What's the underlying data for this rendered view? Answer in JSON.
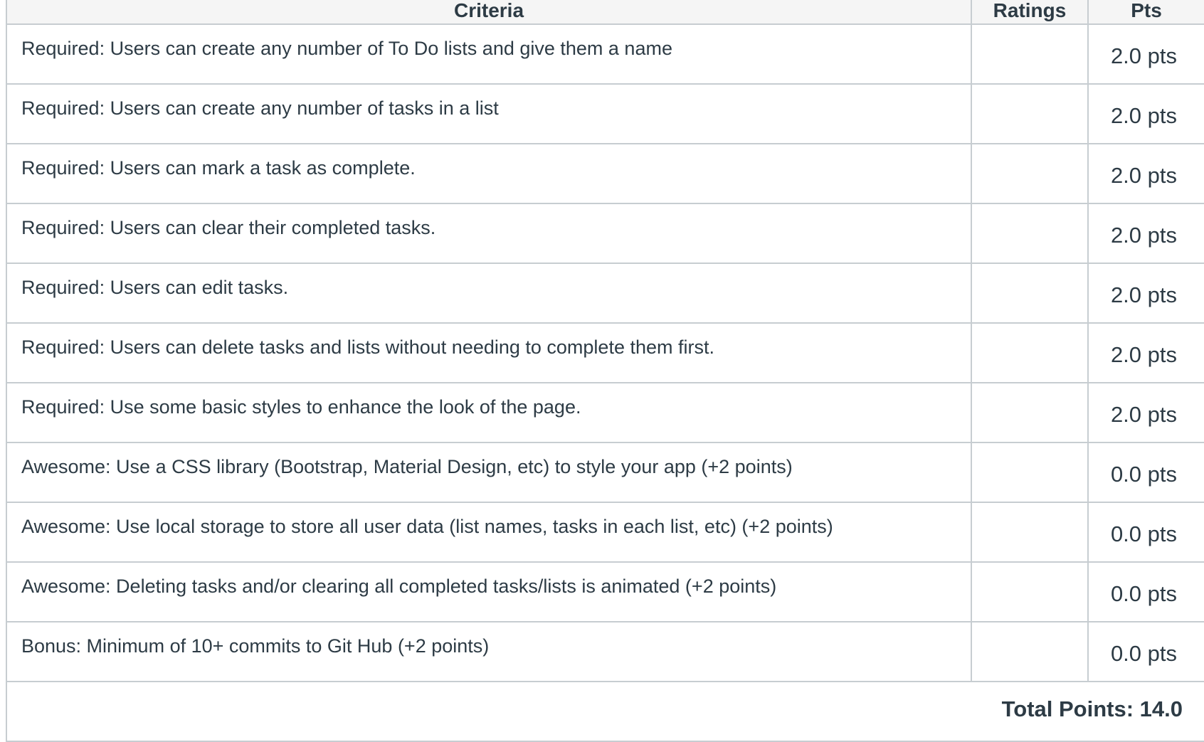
{
  "headers": {
    "criteria": "Criteria",
    "ratings": "Ratings",
    "pts": "Pts"
  },
  "rows": [
    {
      "criteria": "Required: Users can create any number of To Do lists and give them a name",
      "pts": "2.0 pts"
    },
    {
      "criteria": "Required: Users can create any number of tasks in a list",
      "pts": "2.0 pts"
    },
    {
      "criteria": "Required: Users can mark a task as complete.",
      "pts": "2.0 pts"
    },
    {
      "criteria": "Required: Users can clear their completed tasks.",
      "pts": "2.0 pts"
    },
    {
      "criteria": "Required: Users can edit tasks.",
      "pts": "2.0 pts"
    },
    {
      "criteria": "Required: Users can delete tasks and lists without needing to complete them first.",
      "pts": "2.0 pts"
    },
    {
      "criteria": "Required: Use some basic styles to enhance the look of the page.",
      "pts": "2.0 pts"
    },
    {
      "criteria": "Awesome: Use a CSS library (Bootstrap, Material Design, etc) to style your app (+2 points)",
      "pts": "0.0 pts"
    },
    {
      "criteria": "Awesome: Use local storage to store all user data (list names, tasks in each list, etc) (+2 points)",
      "pts": "0.0 pts"
    },
    {
      "criteria": "Awesome: Deleting tasks and/or clearing all completed tasks/lists is animated (+2 points)",
      "pts": "0.0 pts"
    },
    {
      "criteria": "Bonus: Minimum of 10+ commits to Git Hub (+2 points)",
      "pts": "0.0 pts"
    }
  ],
  "total": "Total Points: 14.0"
}
